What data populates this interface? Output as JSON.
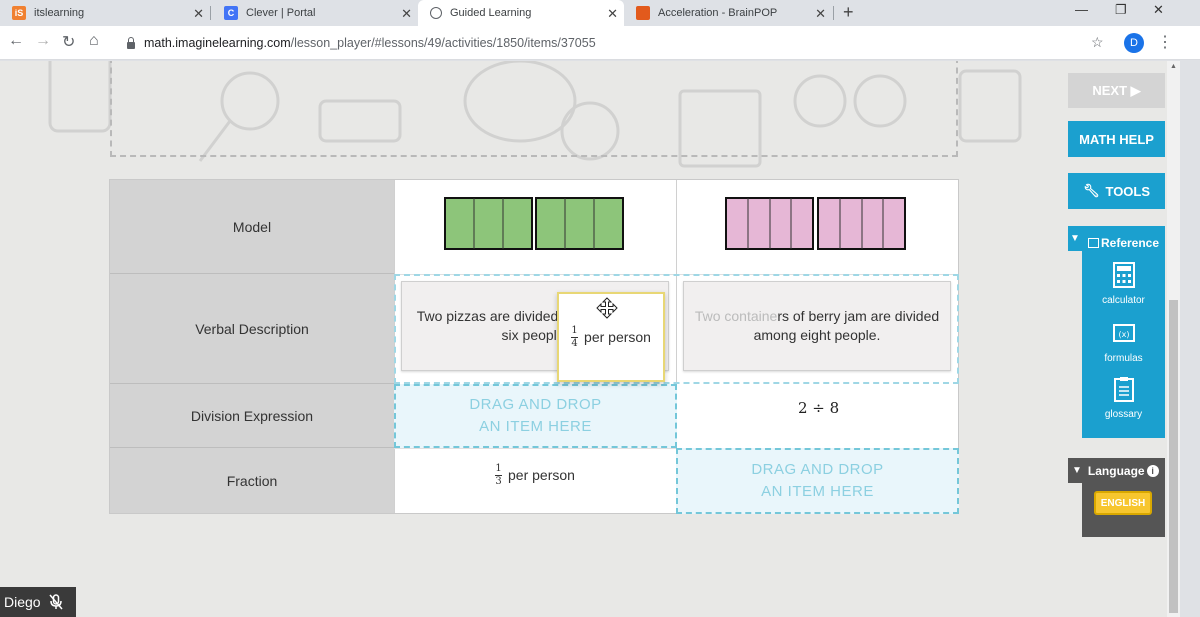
{
  "browser": {
    "tabs": [
      {
        "title": "itslearning",
        "favicon": "itslearning-icon",
        "active": false
      },
      {
        "title": "Clever | Portal",
        "favicon": "clever-icon",
        "active": false
      },
      {
        "title": "Guided Learning",
        "favicon": "globe-icon",
        "active": true
      },
      {
        "title": "Acceleration - BrainPOP",
        "favicon": "brainpop-icon",
        "active": false
      }
    ],
    "url_host": "math.imaginelearning.com",
    "url_path": "/lesson_player/#lessons/49/activities/1850/items/37055",
    "profile_initial": "D"
  },
  "table": {
    "row_labels": [
      "Model",
      "Verbal Description",
      "Division Expression",
      "Fraction"
    ],
    "model": {
      "left": {
        "color": "#8dc57a",
        "groups": 2,
        "parts_per_group": 3
      },
      "right": {
        "color": "#e6b7d6",
        "groups": 2,
        "parts_per_group": 4
      }
    },
    "verbal_left": "Two pizzas are divided equally among six people.",
    "verbal_right_visible": "rs of berry jam are divided",
    "verbal_right_line2": "among eight people.",
    "verbal_right_faint": "Two containe",
    "expr_right": "2 ÷ 8",
    "dropzone_label_line1": "DRAG AND DROP",
    "dropzone_label_line2": "AN ITEM HERE",
    "fraction_left": {
      "numerator": "1",
      "denominator": "3",
      "suffix": "per person"
    }
  },
  "dragged_item": {
    "numerator": "1",
    "denominator": "4",
    "suffix": "per person"
  },
  "side_panel": {
    "next": "NEXT ▶",
    "math_help": "MATH HELP",
    "tools": "TOOLS",
    "reference": "Reference",
    "reference_items": [
      "calculator",
      "formulas",
      "glossary"
    ],
    "language": "Language",
    "english": "ENGLISH"
  },
  "presenter": {
    "name": "Diego"
  },
  "colors": {
    "accent": "#1ba0cf",
    "dropzone_text": "#8cd0e1",
    "english_button": "#f7c62e"
  }
}
